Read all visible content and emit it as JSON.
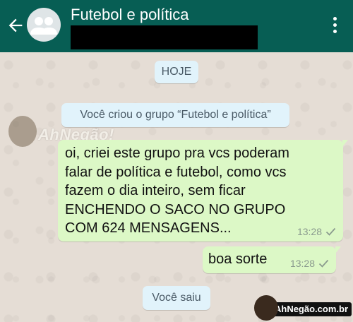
{
  "header": {
    "title": "Futebol e política",
    "colors": {
      "bar": "#075e54",
      "text": "#ffffff"
    },
    "icons": {
      "back": "arrow-left-icon",
      "avatar": "group-avatar-icon",
      "menu": "more-vertical-icon"
    }
  },
  "chat": {
    "date_label": "HOJE",
    "group_created_text": "Você criou o grupo “Futebol e política”",
    "messages": [
      {
        "lines": [
          "oi, criei este grupo pra vcs poderam",
          "falar de política e futebol, como vcs",
          "fazem o dia inteiro, sem ficar",
          "ENCHENDO O SACO NO GRUPO",
          "COM 624 MENSAGENS..."
        ],
        "time": "13:28",
        "status_icon": "single-check-icon"
      },
      {
        "text": "boa sorte",
        "time": "13:28",
        "status_icon": "single-check-icon"
      }
    ],
    "left_text": "Você saiu",
    "colors": {
      "outgoing": "#dcf8c6",
      "system": "#e1f3fb",
      "background": "#e5ddd5"
    }
  },
  "watermark": {
    "logo_text": "AhNegão!",
    "badge_text": "AhNegão.com.br"
  }
}
